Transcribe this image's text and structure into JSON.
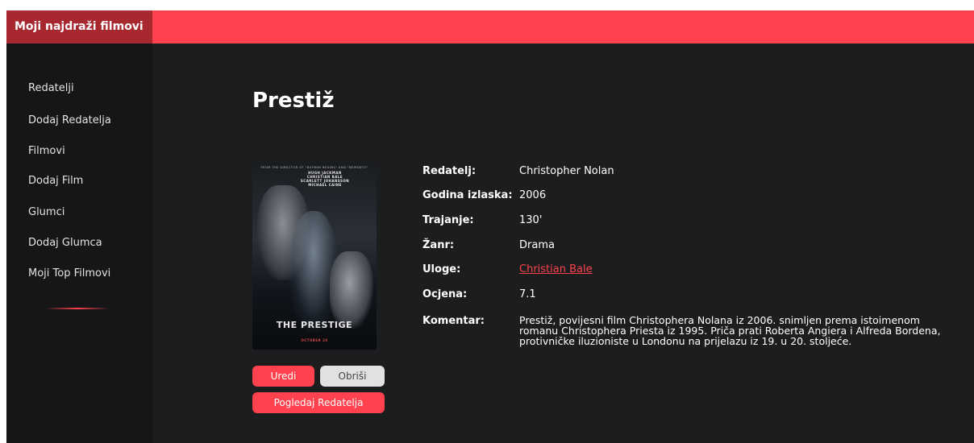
{
  "header": {
    "brand": "Moji najdraži filmovi"
  },
  "sidebar": {
    "items": [
      {
        "label": "Redatelji"
      },
      {
        "label": "Dodaj Redatelja"
      },
      {
        "label": "Filmovi"
      },
      {
        "label": "Dodaj Film"
      },
      {
        "label": "Glumci"
      },
      {
        "label": "Dodaj Glumca"
      },
      {
        "label": "Moji Top Filmovi"
      }
    ]
  },
  "movie": {
    "title": "Prestiž",
    "poster": {
      "tagline": "FROM THE DIRECTOR OF \"BATMAN BEGINS\" AND \"MEMENTO\"",
      "cast": [
        "HUGH JACKMAN",
        "CHRISTIAN BALE",
        "SCARLETT JOHANSSON",
        "MICHAEL CAINE"
      ],
      "movie_name": "THE PRESTIGE",
      "release": "OCTOBER 20"
    },
    "labels": {
      "director": "Redatelj:",
      "year": "Godina izlaska:",
      "duration": "Trajanje:",
      "genre": "Žanr:",
      "roles": "Uloge:",
      "rating": "Ocjena:",
      "comment": "Komentar:"
    },
    "values": {
      "director": "Christopher Nolan",
      "year": "2006",
      "duration": "130'",
      "genre": "Drama",
      "roles": "Christian Bale",
      "rating": "7.1",
      "comment": "Prestiž, povijesni film Christophera Nolana iz 2006. snimljen prema istoimenom romanu Christophera Priesta iz 1995. Priča prati Roberta Angiera i Alfreda Bordena, protivničke iluzioniste u Londonu na prijelazu iz 19. u 20. stoljeće."
    }
  },
  "actions": {
    "edit_label": "Uredi",
    "delete_label": "Obriši",
    "view_director_label": "Pogledaj Redatelja"
  },
  "colors": {
    "accent": "#ff424d",
    "brand_bg": "#a8282f",
    "content_bg": "#1c1d1f",
    "sidebar_bg": "#161618"
  }
}
